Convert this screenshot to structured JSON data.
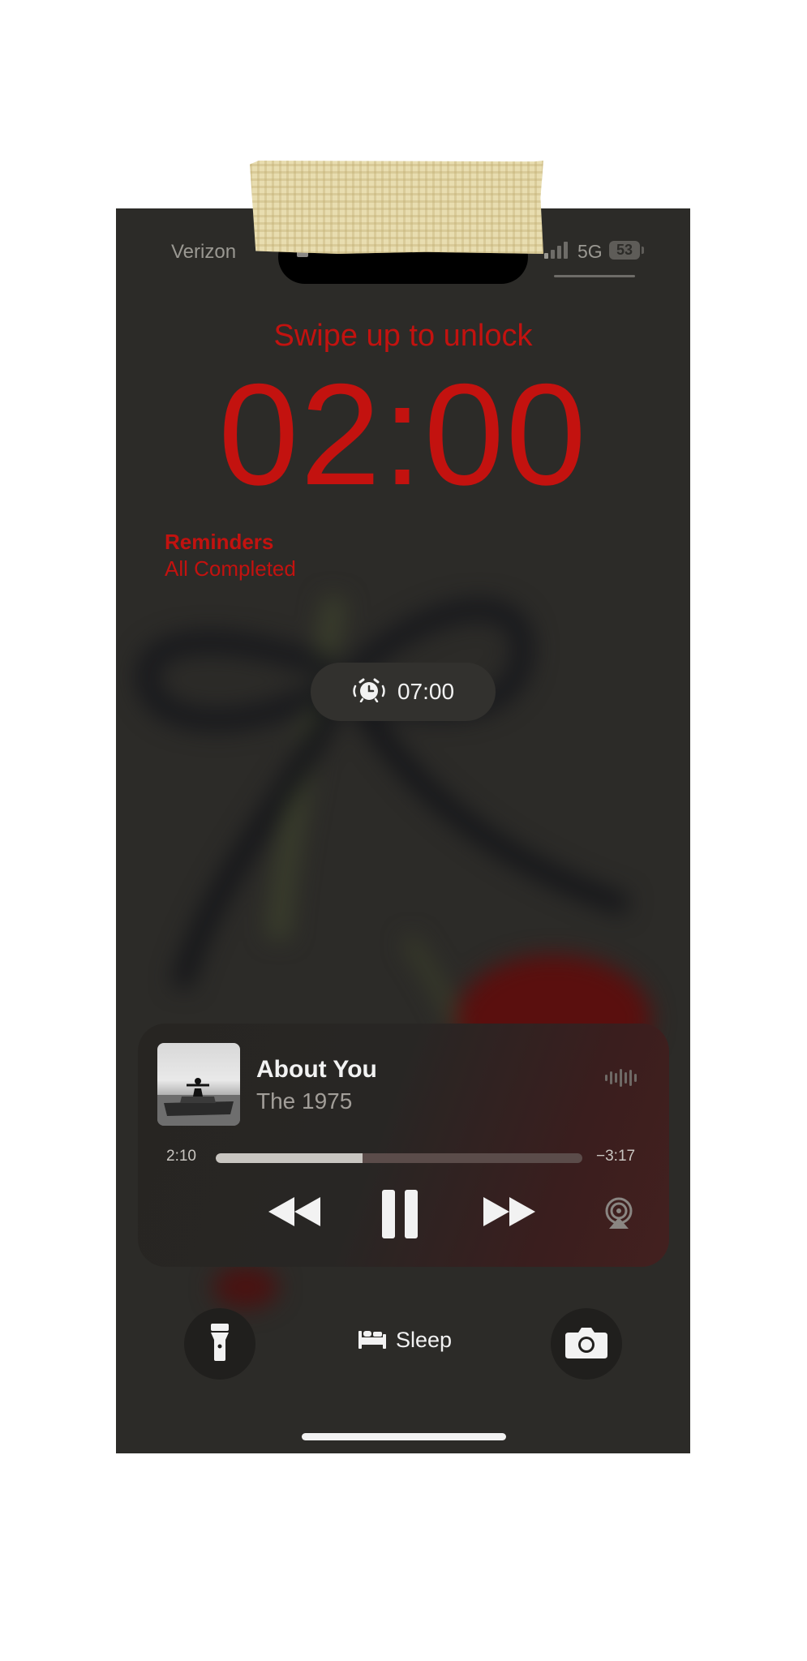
{
  "status_bar": {
    "carrier": "Verizon",
    "network": "5G",
    "battery": "53",
    "signal_bars": 4,
    "signal_active_bars": 1
  },
  "lock_screen": {
    "swipe_hint": "Swipe up to unlock",
    "time": "02:00",
    "widget": {
      "title": "Reminders",
      "status": "All Completed"
    },
    "alarm": {
      "icon": "alarm-clock-icon",
      "time": "07:00"
    }
  },
  "now_playing": {
    "song": "About You",
    "artist": "The 1975",
    "elapsed": "2:10",
    "remaining": "−3:17",
    "progress": 0.4,
    "icons": [
      "rewind-icon",
      "pause-icon",
      "fast-forward-icon",
      "airplay-icon",
      "waveform-icon"
    ]
  },
  "bottom_bar": {
    "flashlight_icon": "flashlight-icon",
    "focus_label": "Sleep",
    "focus_icon": "bed-icon",
    "camera_icon": "camera-icon"
  },
  "colors": {
    "accent": "#c3120f",
    "background": "#2c2b28",
    "tape": "#e8ddb0"
  }
}
